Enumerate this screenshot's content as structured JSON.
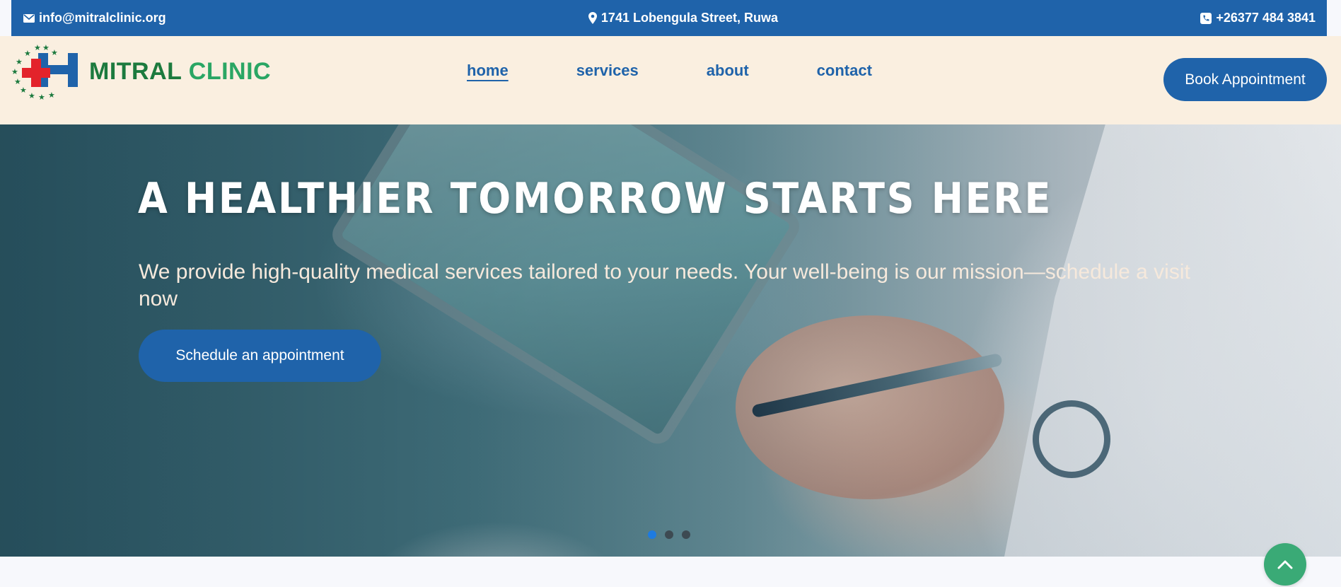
{
  "topbar": {
    "email": "info@mitralclinic.org",
    "address": "1741 Lobengula Street, Ruwa",
    "phone": "+26377 484 3841",
    "icons": [
      "envelope-icon",
      "map-pin-icon",
      "phone-icon"
    ],
    "background": "#1f63aa"
  },
  "brand": {
    "word1": "MITRAL",
    "word2": "CLINIC",
    "colors": {
      "word1": "#1c7a3e",
      "word2": "#2aa664",
      "cross": "#e3232b",
      "h": "#1f63aa"
    }
  },
  "nav": {
    "items": [
      {
        "label": "home",
        "active": true
      },
      {
        "label": "services",
        "active": false
      },
      {
        "label": "about",
        "active": false
      },
      {
        "label": "contact",
        "active": false
      }
    ],
    "cta": "Book Appointment"
  },
  "hero": {
    "title": "A HEALTHIER TOMORROW STARTS HERE",
    "subtitle": "We provide high-quality medical services tailored to your needs. Your well-being is our mission—schedule a visit now",
    "button": "Schedule an appointment",
    "slides": {
      "count": 3,
      "active": 1
    }
  },
  "scroll_top_icon": "chevron-up-icon",
  "accent": "#1f63aa",
  "header_bg": "#faefe0"
}
